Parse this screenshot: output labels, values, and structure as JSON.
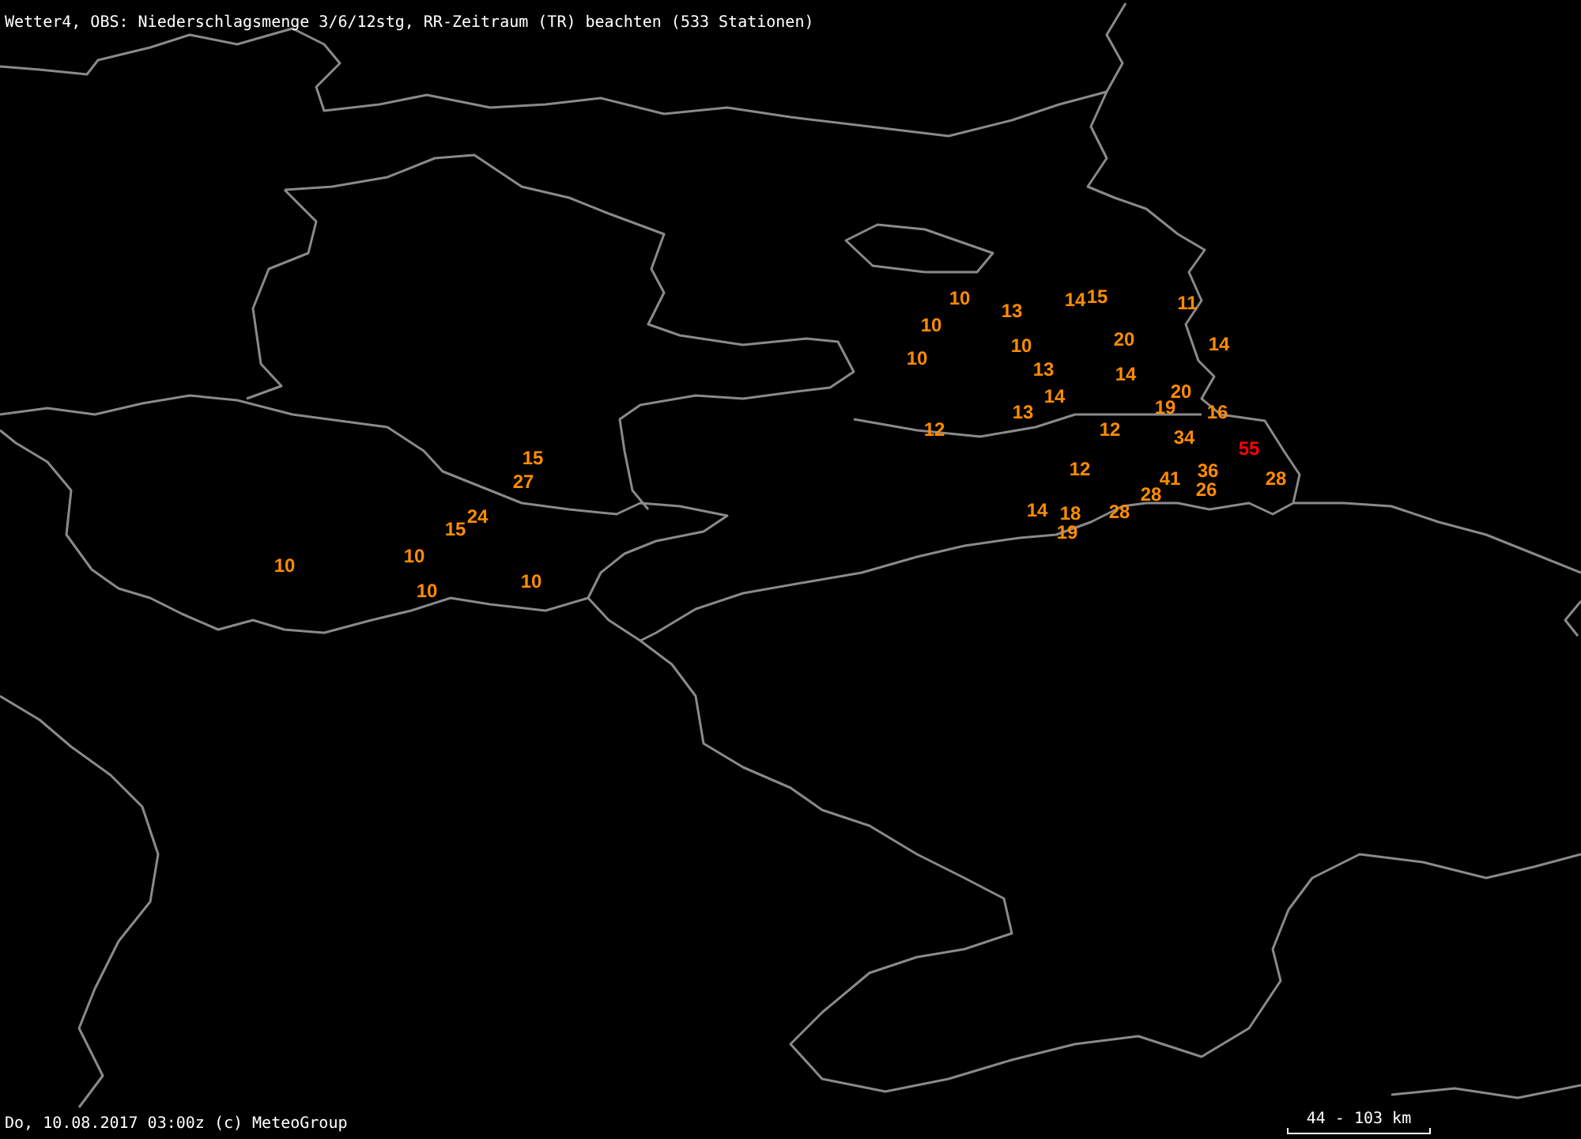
{
  "title": "Wetter4, OBS: Niederschlagsmenge 3/6/12stg, RR-Zeitraum (TR) beachten (533 Stationen)",
  "stations": [
    {
      "value": "10",
      "color": "#ff8c00"
    },
    {
      "value": "14",
      "color": "#ff8c00"
    },
    {
      "value": "15",
      "color": "#ff8c00"
    },
    {
      "value": "11",
      "color": "#ff8c00"
    },
    {
      "value": "13",
      "color": "#ff8c00"
    },
    {
      "value": "10",
      "color": "#ff8c00"
    },
    {
      "value": "10",
      "color": "#ff8c00"
    },
    {
      "value": "20",
      "color": "#ff8c00"
    },
    {
      "value": "14",
      "color": "#ff8c00"
    },
    {
      "value": "10",
      "color": "#ff8c00"
    },
    {
      "value": "13",
      "color": "#ff8c00"
    },
    {
      "value": "14",
      "color": "#ff8c00"
    },
    {
      "value": "14",
      "color": "#ff8c00"
    },
    {
      "value": "20",
      "color": "#ff8c00"
    },
    {
      "value": "13",
      "color": "#ff8c00"
    },
    {
      "value": "19",
      "color": "#ff8c00"
    },
    {
      "value": "16",
      "color": "#ff8c00"
    },
    {
      "value": "12",
      "color": "#ff8c00"
    },
    {
      "value": "12",
      "color": "#ff8c00"
    },
    {
      "value": "34",
      "color": "#ff8c00"
    },
    {
      "value": "55",
      "color": "#ff0000"
    },
    {
      "value": "15",
      "color": "#ff8c00"
    },
    {
      "value": "12",
      "color": "#ff8c00"
    },
    {
      "value": "36",
      "color": "#ff8c00"
    },
    {
      "value": "27",
      "color": "#ff8c00"
    },
    {
      "value": "41",
      "color": "#ff8c00"
    },
    {
      "value": "28",
      "color": "#ff8c00"
    },
    {
      "value": "28",
      "color": "#ff8c00"
    },
    {
      "value": "26",
      "color": "#ff8c00"
    },
    {
      "value": "24",
      "color": "#ff8c00"
    },
    {
      "value": "14",
      "color": "#ff8c00"
    },
    {
      "value": "18",
      "color": "#ff8c00"
    },
    {
      "value": "28",
      "color": "#ff8c00"
    },
    {
      "value": "15",
      "color": "#ff8c00"
    },
    {
      "value": "19",
      "color": "#ff8c00"
    },
    {
      "value": "10",
      "color": "#ff8c00"
    },
    {
      "value": "10",
      "color": "#ff8c00"
    },
    {
      "value": "10",
      "color": "#ff8c00"
    },
    {
      "value": "10",
      "color": "#ff8c00"
    }
  ],
  "footer": {
    "caption": "Do, 10.08.2017 03:00z (c) MeteoGroup",
    "scale_label": "44 - 103 km"
  }
}
